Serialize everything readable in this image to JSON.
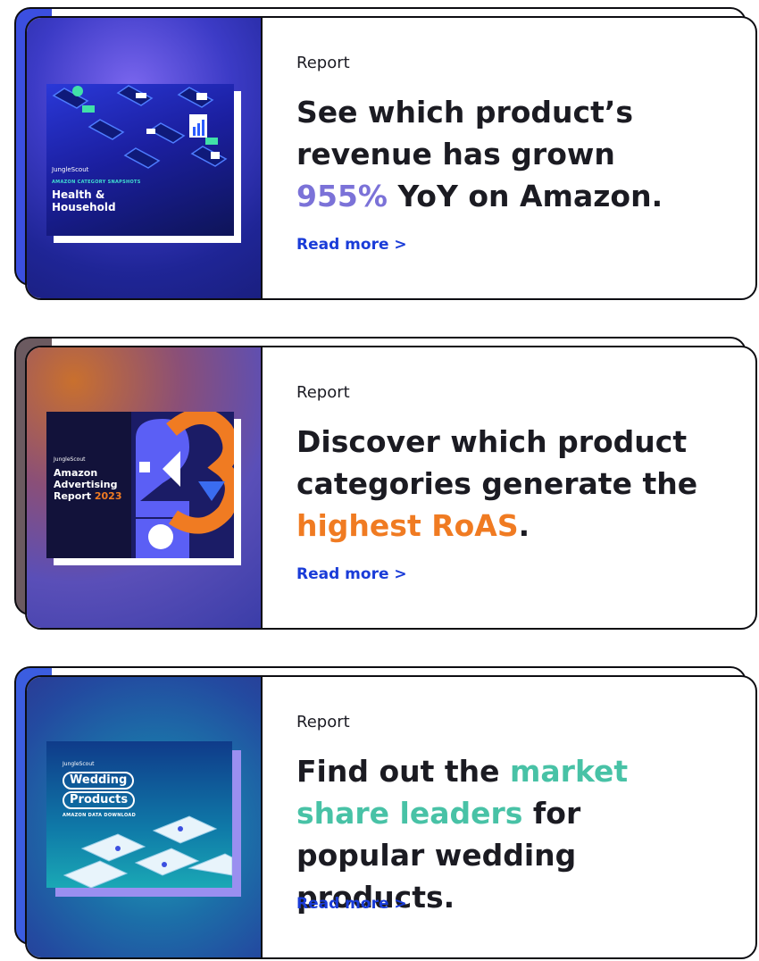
{
  "cards": [
    {
      "tag": "Report",
      "headline_pre": "See which product’s revenue has grown ",
      "headline_accent": "955%",
      "headline_post": " YoY on Amazon.",
      "accent_color": "#7b72d8",
      "read_more": "Read more >",
      "cover": {
        "brand": "JungleScout",
        "kicker": "AMAZON CATEGORY SNAPSHOTS",
        "title_line1": "Health &",
        "title_line2": "Household"
      }
    },
    {
      "tag": "Report",
      "headline_pre": "Discover which product categories generate the ",
      "headline_accent": "highest RoAS",
      "headline_post": ".",
      "accent_color": "#f07b22",
      "read_more": "Read more >",
      "cover": {
        "brand": "JungleScout",
        "title_line1": "Amazon",
        "title_line2": "Advertising",
        "title_line3a": "Report ",
        "title_line3b": "2023"
      }
    },
    {
      "tag": "Report",
      "headline_pre": "Find out the ",
      "headline_accent": "market share leaders",
      "headline_post": " for popular wedding products.",
      "accent_color": "#48c2a6",
      "read_more": "Read more >",
      "cover": {
        "brand": "JungleScout",
        "title_line1": "Wedding",
        "title_line2": "Products",
        "kicker": "AMAZON DATA DOWNLOAD"
      }
    }
  ],
  "colors": {
    "link": "#1a3cd8",
    "border": "#0d0d12"
  }
}
